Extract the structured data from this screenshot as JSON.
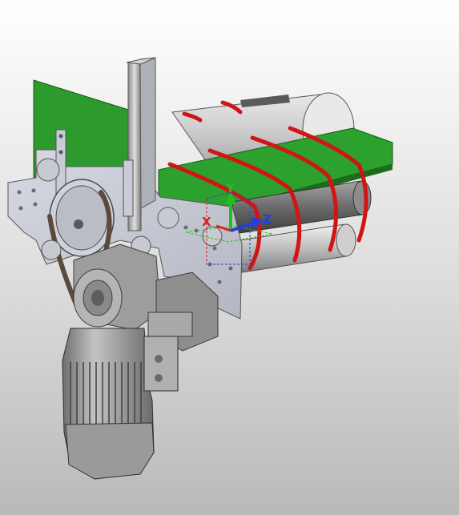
{
  "viewport": {
    "background_top": "#ffffff",
    "background_bottom": "#b9b9b9"
  },
  "model": {
    "plate_color": "#c9ccd6",
    "belt_color": "#2c9a2c",
    "cleat_color": "#d01515",
    "roller_color": "#d8d8d8",
    "motor_color": "#a3a3a3"
  },
  "triad": {
    "x_label": "X",
    "y_label": "Y",
    "z_label": "Z",
    "x_color": "#e02020",
    "y_color": "#20c020",
    "z_color": "#2040e0"
  }
}
